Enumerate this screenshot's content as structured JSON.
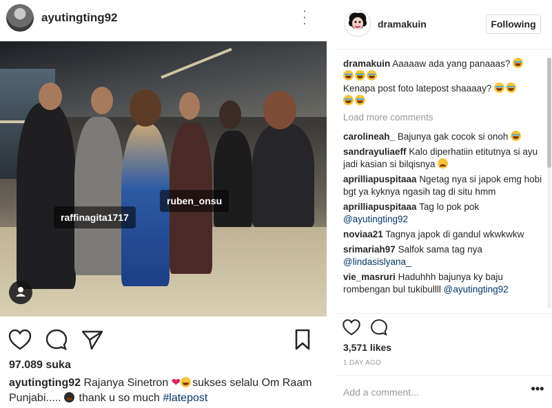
{
  "post": {
    "username": "ayutingting92",
    "tags": [
      "ruben_onsu",
      "raffinagita1717"
    ],
    "likes_text": "97.089 suka",
    "caption": {
      "user": "ayutingting92",
      "text1": "Rajanya Sinetron",
      "text2": "sukses selalu Om Raam Punjabi.....",
      "text3": "thank u so much",
      "hashtag": "#latepost"
    }
  },
  "detail": {
    "username": "dramakuin",
    "follow_button": "Following",
    "owner_comment": {
      "user": "dramakuin",
      "line1": "Aaaaaw ada yang panaaas?",
      "line2": "Kenapa post foto latepost shaaaay?"
    },
    "load_more": "Load more comments",
    "comments": [
      {
        "user": "carolineah_",
        "text": "Bajunya gak cocok si onoh",
        "emoji": "cry"
      },
      {
        "user": "sandrayuliaeff",
        "text": "Kalo diperhatiin etitutnya si ayu jadi kasian si bilqisnya",
        "emoji": "frown"
      },
      {
        "user": "aprilliapuspitaaa",
        "text": "Ngetag nya si japok emg hobi bgt ya kyknya ngasih tag di situ hmm",
        "emoji": ""
      },
      {
        "user": "aprilliapuspitaaa",
        "text": "Tag lo pok pok",
        "mention": "@ayutingting92",
        "emoji": ""
      },
      {
        "user": "noviaa21",
        "text": "Tagnya japok di gandul wkwkwkw",
        "emoji": ""
      },
      {
        "user": "srimariah97",
        "text": "Salfok sama tag nya",
        "mention": "@lindasislyana_",
        "emoji": ""
      },
      {
        "user": "vie_masruri",
        "text": "Haduhhh bajunya ky baju rombengan bul tukibullll",
        "mention": "@ayutingting92",
        "emoji": ""
      }
    ],
    "likes_text": "3,571 likes",
    "time_text": "1 DAY AGO",
    "comment_placeholder": "Add a comment...",
    "more_label": "•••"
  }
}
